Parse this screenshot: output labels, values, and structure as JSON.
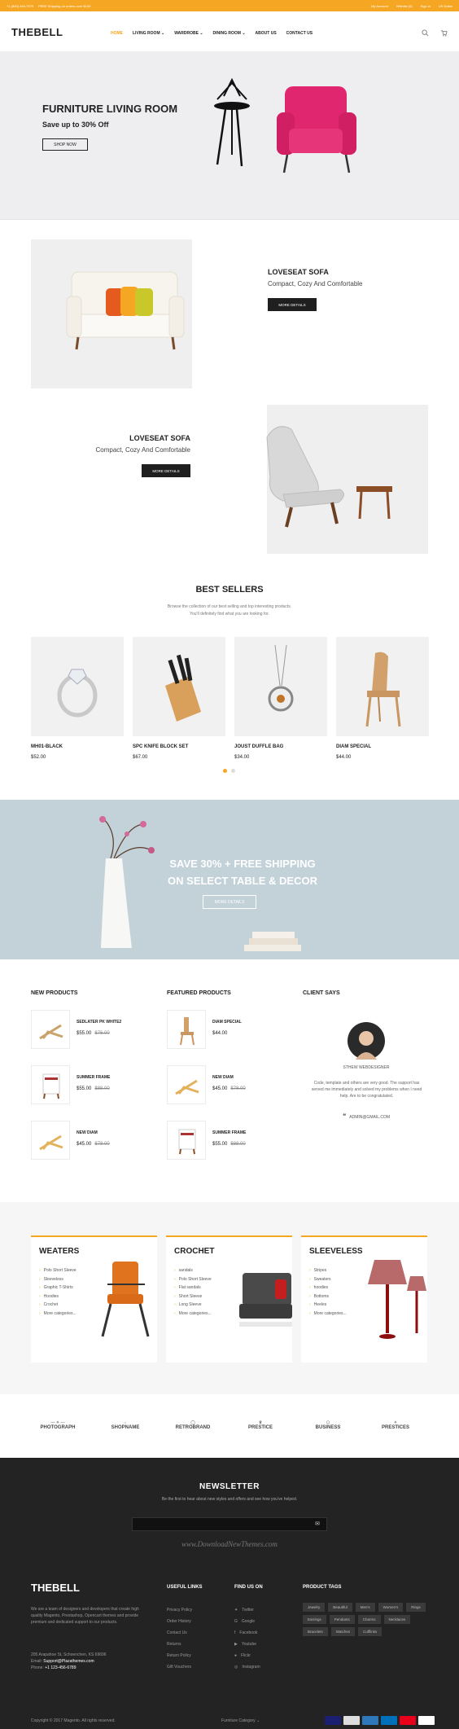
{
  "topbar": {
    "phone": "+1 (800) 345-7579",
    "shipping": "FREE Shipping on orders over $100",
    "my_account": "My Account",
    "wishlist": "Wishlist (0)",
    "sign_in": "Sign in",
    "currency": "US Dollar"
  },
  "header": {
    "logo": "THEBELL",
    "nav": [
      "HOME",
      "LIVING ROOM ⌄",
      "WARDROBE ⌄",
      "DINING ROOM ⌄",
      "ABOUT US",
      "CONTACT US"
    ],
    "icons": [
      "search-icon",
      "cart-icon"
    ]
  },
  "hero": {
    "title": "FURNITURE LIVING ROOM",
    "subtitle": "Save up to 30% Off",
    "button": "SHOP NOW",
    "accent": "#e0266f"
  },
  "feature1": {
    "title": "LOVESEAT SOFA",
    "subtitle": "Compact, Cozy And Comfortable",
    "button": "MORE DETAILS"
  },
  "feature2": {
    "title": "LOVESEAT SOFA",
    "subtitle": "Compact, Cozy And Comfortable",
    "button": "MORE DETAILS"
  },
  "best_sellers": {
    "title": "BEST SELLERS",
    "desc1": "Browse the collection of our best selling and top interesting products.",
    "desc2": "You'll definitely find what you are looking for.",
    "products": [
      {
        "name": "MH01-BLACK",
        "price": "$52.00"
      },
      {
        "name": "SPC KNIFE BLOCK SET",
        "price": "$67.00"
      },
      {
        "name": "JOUST DUFFLE BAG",
        "price": "$34.00"
      },
      {
        "name": "DIAM SPECIAL",
        "price": "$44.00"
      }
    ]
  },
  "promo": {
    "line1": "SAVE 30% + FREE SHIPPING",
    "line2": "ON SELECT TABLE & DECOR",
    "button": "MORE DETAILS"
  },
  "lists": {
    "new_title": "NEW PRODUCTS",
    "featured_title": "FEATURED PRODUCTS",
    "client_title": "CLIENT SAYS",
    "new_items": [
      {
        "name": "SEDLATER PK WHITE2",
        "price": "$55.00",
        "old": "$76.00"
      },
      {
        "name": "SUMMER FRAME",
        "price": "$55.00",
        "old": "$88.00"
      },
      {
        "name": "NEW DIAM",
        "price": "$45.00",
        "old": "$78.00"
      }
    ],
    "featured_items": [
      {
        "name": "DIAM SPECIAL",
        "price": "$44.00",
        "old": ""
      },
      {
        "name": "NEW DIAM",
        "price": "$45.00",
        "old": "$78.00"
      },
      {
        "name": "SUMMER FRAME",
        "price": "$55.00",
        "old": "$88.00"
      }
    ]
  },
  "testimonial": {
    "name": "STHEW WEBDESIGNER",
    "text": "Code, template and others are very good. The support has served me immediately and solved my problems when I need help. Are to be congratulated.",
    "email": "ADMIN@GMAIL.COM"
  },
  "categories": [
    {
      "title": "WEATERS",
      "items": [
        "Polo Short Sleeve",
        "Sleeveless",
        "Graphic T-Shirts",
        "Hoodies",
        "Crochet",
        "More categories..."
      ]
    },
    {
      "title": "CROCHET",
      "items": [
        "sandals",
        "Polo Short Sleeve",
        "Flat sandals",
        "Short Sleeve",
        "Long Sleeve",
        "More categories..."
      ]
    },
    {
      "title": "SLEEVELESS",
      "items": [
        "Stripes",
        "Sweaters",
        "hoodies",
        "Bottoms",
        "Heeles",
        "More categories..."
      ]
    }
  ],
  "brands": [
    "PHOTOGRAPH",
    "SHOPNAME",
    "RETROBRAND",
    "PRESTICE",
    "BUSINESS",
    "PRESTICES"
  ],
  "newsletter": {
    "title": "NEWSLETTER",
    "desc": "Be the first to hear about new styles and offers and see how you've helped.",
    "watermark": "www.DownloadNewThemes.com"
  },
  "footer": {
    "logo": "THEBELL",
    "about": "We are a team of designers and developers that create high quality Magento, Prestashop, Opencart themes and provide premium and dedicated support to our products.",
    "address": "205 Arapahoe St, Schoenchen, KS 69696",
    "email_label": "Email:",
    "email": "Support@Plazathemes.com",
    "phone_label": "Phone:",
    "phone": "+1 123-456-6789",
    "useful_title": "USEFUL LINKS",
    "useful": [
      "Privacy Policy",
      "Order History",
      "Contact Us",
      "Returns",
      "Return Policy",
      "Gift Vouchers"
    ],
    "find_title": "FIND US ON",
    "find": [
      "Twitter",
      "Google",
      "Facebook",
      "Youtube",
      "Flickr",
      "Instagram"
    ],
    "tags_title": "PRODUCT TAGS",
    "tags": [
      "Jewelry",
      "Beautiful",
      "Men's",
      "Women's",
      "Rings",
      "Earrings",
      "Pendants",
      "Charms",
      "Necklaces",
      "Bracelets",
      "Watches",
      "Cufflinks"
    ],
    "copyright": "Copyright © 2017 Magento. All rights reserved.",
    "furniture_cat": "Furniture Category ⌄",
    "payments": [
      "#1a1f71",
      "#dddddd",
      "#2e77bb",
      "#0070ba",
      "#eb001b",
      "#ffffff"
    ]
  }
}
